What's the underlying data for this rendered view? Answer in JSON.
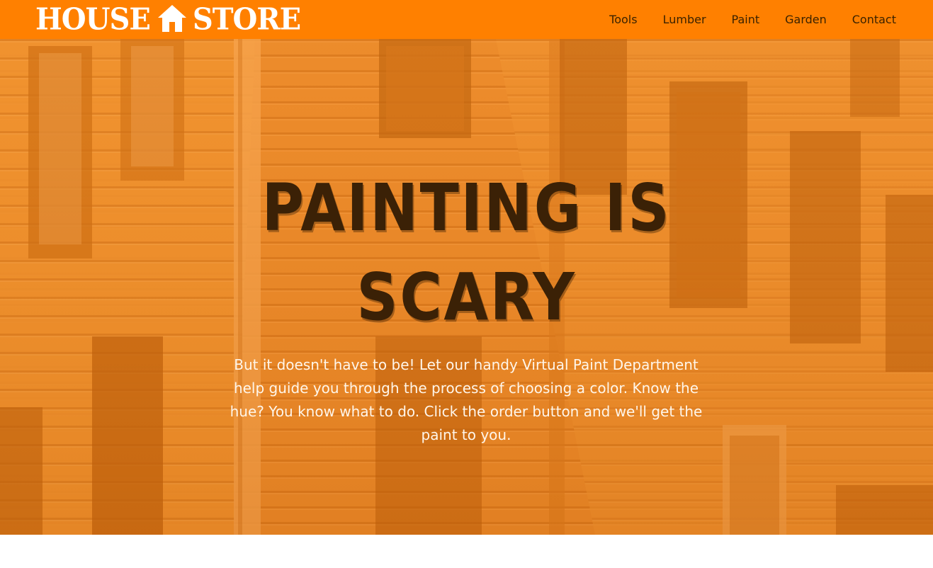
{
  "brand": {
    "left_word": "HOUSE",
    "right_word": "STORE",
    "icon": "house-icon"
  },
  "nav": {
    "items": [
      {
        "label": "Tools"
      },
      {
        "label": "Lumber"
      },
      {
        "label": "Paint"
      },
      {
        "label": "Garden"
      },
      {
        "label": "Contact"
      }
    ]
  },
  "hero": {
    "title": "PAINTING IS SCARY",
    "text": "But it doesn't have to be! Let our handy Virtual Paint Department help guide you through the process of choosing a color. Know the hue? You know what to do. Click the order button and we'll get the paint to you."
  },
  "colors": {
    "nav_background": "#ff8000",
    "hero_tint": "#f08a24",
    "title_color": "#3b2106",
    "text_color": "#fff6ea"
  }
}
